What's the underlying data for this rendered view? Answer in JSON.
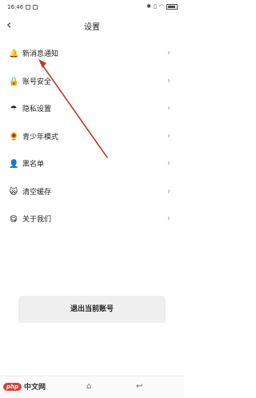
{
  "status_bar": {
    "time": "16:46"
  },
  "header": {
    "back_icon": "back-chevron",
    "title": "设置"
  },
  "menu": [
    {
      "label": "新消息通知",
      "icon": "bell-icon",
      "glyph": "🔔"
    },
    {
      "label": "账号安全",
      "icon": "lock-icon",
      "glyph": "🔒"
    },
    {
      "label": "隐私设置",
      "icon": "umbrella-icon",
      "glyph": "☂"
    },
    {
      "label": "青少年模式",
      "icon": "sunflower-icon",
      "glyph": "🌻"
    },
    {
      "label": "黑名单",
      "icon": "person-icon",
      "glyph": "👤"
    },
    {
      "label": "清空缓存",
      "icon": "face-icon",
      "glyph": "🙀"
    },
    {
      "label": "关于我们",
      "icon": "smile-icon",
      "glyph": "😋"
    }
  ],
  "chevron": "›",
  "logout_label": "退出当前账号",
  "watermark": {
    "badge": "php",
    "text": "中文网"
  },
  "annotation_color": "#c0392b"
}
